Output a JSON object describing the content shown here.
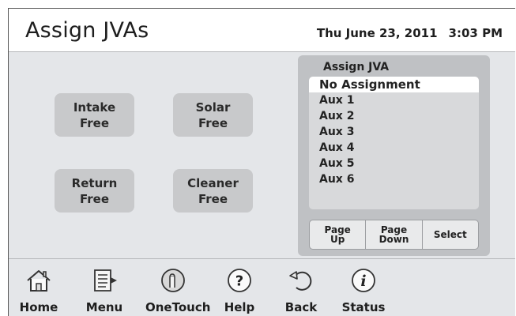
{
  "header": {
    "title": "Assign JVAs",
    "date": "Thu June 23, 2011",
    "time": "3:03 PM"
  },
  "valves": [
    {
      "name": "Intake",
      "status": "Free"
    },
    {
      "name": "Solar",
      "status": "Free"
    },
    {
      "name": "Return",
      "status": "Free"
    },
    {
      "name": "Cleaner",
      "status": "Free"
    }
  ],
  "assign_panel": {
    "title": "Assign JVA",
    "items": [
      "No Assignment",
      "Aux 1",
      "Aux 2",
      "Aux 3",
      "Aux 4",
      "Aux 5",
      "Aux 6"
    ],
    "selected_index": 0,
    "buttons": {
      "page_up": "Page\nUp",
      "page_down": "Page\nDown",
      "select": "Select"
    }
  },
  "toolbar": {
    "home": "Home",
    "menu": "Menu",
    "onetouch": "OneTouch",
    "help": "Help",
    "back": "Back",
    "status": "Status"
  }
}
